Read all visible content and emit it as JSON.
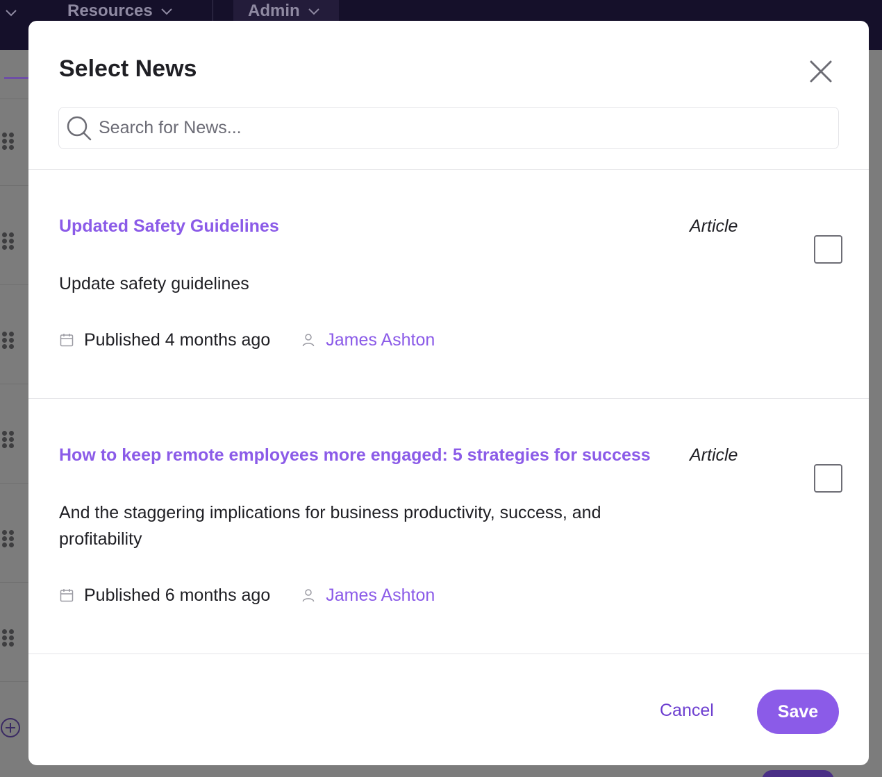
{
  "background": {
    "nav": {
      "resources_label": "Resources",
      "admin_label": "Admin"
    }
  },
  "modal": {
    "title": "Select News",
    "search": {
      "placeholder": "Search for News...",
      "value": ""
    },
    "items": [
      {
        "title": "Updated Safety Guidelines",
        "type": "Article",
        "description": "Update safety guidelines",
        "published": "Published 4 months ago",
        "author": "James Ashton",
        "checked": false
      },
      {
        "title": "How to keep remote employees more engaged: 5 strategies for success",
        "type": "Article",
        "description": "And the staggering implications for business productivity, success, and profitability",
        "published": "Published 6 months ago",
        "author": "James Ashton",
        "checked": false
      }
    ],
    "footer": {
      "cancel_label": "Cancel",
      "save_label": "Save"
    }
  },
  "colors": {
    "accent": "#8b5be8",
    "nav_bg": "#15102a",
    "text": "#1f1f24"
  }
}
